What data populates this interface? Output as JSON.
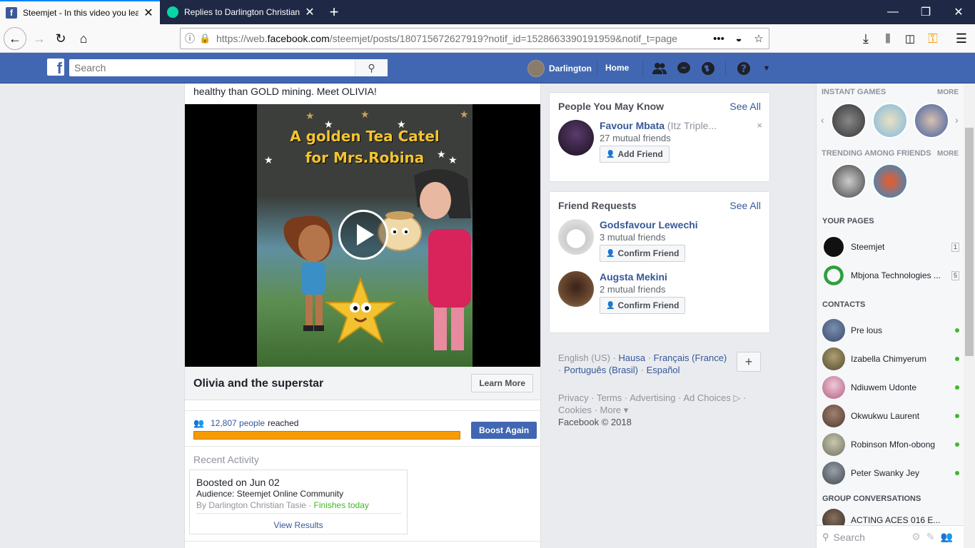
{
  "browser": {
    "tabs": [
      {
        "title": "Steemjet - In this video you lea",
        "close": "✕"
      },
      {
        "title": "Replies to Darlington Christian",
        "close": "✕"
      }
    ],
    "new_tab": "+",
    "window": {
      "minimize": "—",
      "maximize": "❐",
      "close": "✕"
    },
    "url_prefix": "https://web.",
    "url_domain": "facebook.com",
    "url_rest": "/steemjet/posts/180715672627919?notif_id=1528663390191959&notif_t=page",
    "page_actions": "•••"
  },
  "fb_header": {
    "logo": "f",
    "search_placeholder": "Search",
    "user_name": "Darlington",
    "home_label": "Home"
  },
  "post": {
    "text": "healthy than GOLD mining. Meet OLIVIA!",
    "video_title_line1": "A golden Tea Catel",
    "video_title_line2": "for Mrs.Robina",
    "link_title": "Olivia and the superstar",
    "learn_more": "Learn More",
    "reach_count": "12,807 people",
    "reach_suffix": "reached",
    "reach_progress": 1.0,
    "boost_again": "Boost Again",
    "recent_activity": "Recent Activity",
    "boosted_on": "Boosted on Jun 02",
    "audience": "Audience: Steemjet Online Community",
    "by": "By Darlington Christian Tasie",
    "status": "Finishes today",
    "view_results": "View Results"
  },
  "people_you_may_know": {
    "title": "People You May Know",
    "see_all": "See All",
    "items": [
      {
        "name": "Favour Mbata",
        "extra": "(Itz Triple...",
        "mutual": "27 mutual friends",
        "action": "Add Friend",
        "dismiss": "×"
      }
    ]
  },
  "friend_requests": {
    "title": "Friend Requests",
    "see_all": "See All",
    "items": [
      {
        "name": "Godsfavour Lewechi",
        "mutual": "3 mutual friends",
        "action": "Confirm Friend"
      },
      {
        "name": "Augsta Mekini",
        "mutual": "2 mutual friends",
        "action": "Confirm Friend"
      }
    ]
  },
  "languages": {
    "current": "English (US)",
    "options": [
      "Hausa",
      "Français (France)",
      "Português (Brasil)",
      "Español"
    ],
    "add": "+"
  },
  "footer": {
    "links": [
      "Privacy",
      "Terms",
      "Advertising",
      "Ad Choices",
      "Cookies",
      "More"
    ],
    "copyright": "Facebook © 2018"
  },
  "sidebar": {
    "instant_games": "INSTANT GAMES",
    "trending": "TRENDING AMONG FRIENDS",
    "more": "MORE",
    "your_pages": "YOUR PAGES",
    "pages": [
      {
        "name": "Steemjet",
        "count": "1"
      },
      {
        "name": "Mbjona Technologies ...",
        "count": "5"
      }
    ],
    "contacts_title": "CONTACTS",
    "contacts": [
      "Pre lous",
      "Izabella Chimyerum",
      "Ndiuwem Udonte",
      "Okwukwu Laurent",
      "Robinson Mfon-obong",
      "Peter Swanky Jey"
    ],
    "group_conversations": "GROUP CONVERSATIONS",
    "groups": [
      "ACTING ACES 016 E..."
    ],
    "search_placeholder": "Search"
  },
  "colors": {
    "fb_blue": "#4267b2",
    "link": "#365899",
    "online": "#42b72a",
    "progress": "#f79c00"
  }
}
